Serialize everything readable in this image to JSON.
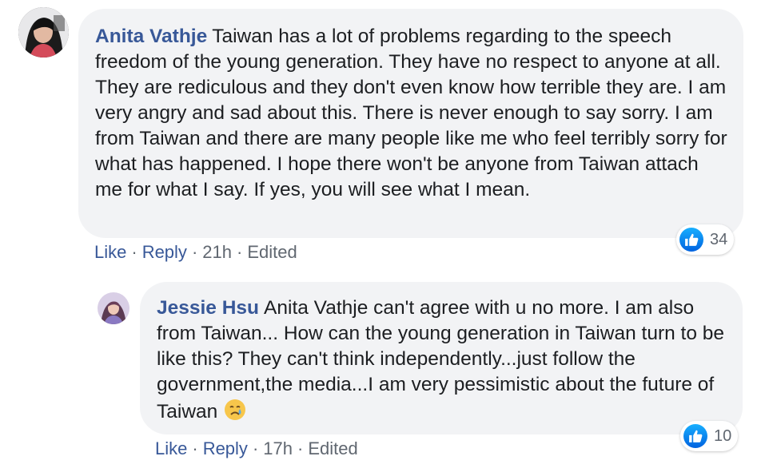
{
  "comments": [
    {
      "author": "Anita Vathje",
      "text": "Taiwan has a lot of problems regarding to the speech freedom of the young generation. They have no respect to anyone at all. They are rediculous and they don't even know how terrible they are. I am very angry and sad about this. There is never enough to say sorry. I am from Taiwan and there are many people like me who feel terribly sorry for what has happened. I hope there won't be anyone from Taiwan attach me for what I say. If yes, you will see what I mean.",
      "actions": {
        "like": "Like",
        "reply": "Reply",
        "time": "21h",
        "edited": "Edited"
      },
      "reaction_count": "34",
      "reaction_icon": "like-icon"
    },
    {
      "author": "Jessie Hsu",
      "text": "Anita Vathje can't agree with u no more. I am also from Taiwan... How can the young generation in Taiwan turn to be like this? They can't think independently...just follow the government,the media...I am very pessimistic about the future of Taiwan",
      "emoji": "crying-face-emoji",
      "actions": {
        "like": "Like",
        "reply": "Reply",
        "time": "17h",
        "edited": "Edited"
      },
      "reaction_count": "10",
      "reaction_icon": "like-icon"
    }
  ],
  "colors": {
    "author": "#385898",
    "bubble": "#f2f3f5",
    "meta": "#606770",
    "like_blue": "#1877f2"
  }
}
